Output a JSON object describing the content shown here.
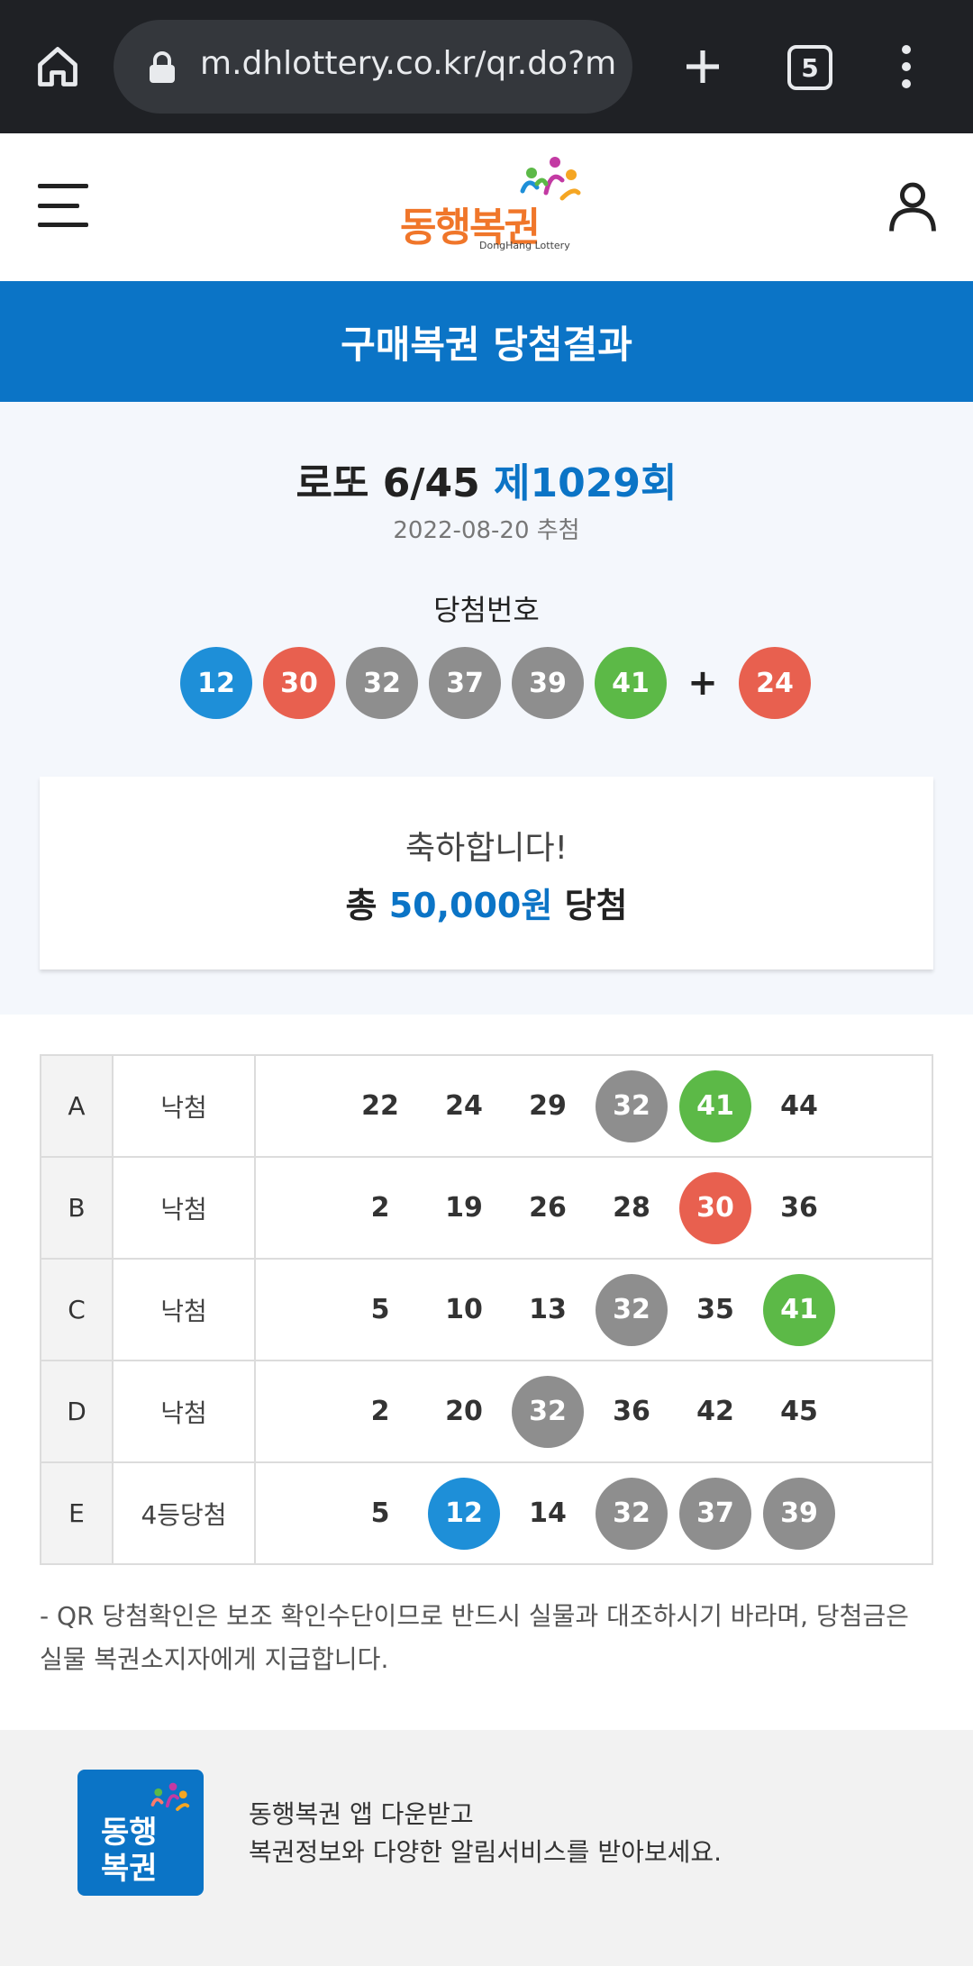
{
  "browser": {
    "url": "m.dhlottery.co.kr/qr.do?method=winQr",
    "tab_count": "5"
  },
  "header": {
    "logo_text": "동행복권",
    "logo_sub": "DongHang Lottery"
  },
  "banner": {
    "title": "구매복권 당첨결과"
  },
  "draw": {
    "game_name": "로또 6/45",
    "round": "제1029회",
    "date": "2022-08-20 추첨",
    "win_label": "당첨번호",
    "numbers": [
      {
        "value": "12",
        "color": "#1e8fd8"
      },
      {
        "value": "30",
        "color": "#e8604f"
      },
      {
        "value": "32",
        "color": "#8e8e8e"
      },
      {
        "value": "37",
        "color": "#8e8e8e"
      },
      {
        "value": "39",
        "color": "#8e8e8e"
      },
      {
        "value": "41",
        "color": "#5cb947"
      }
    ],
    "plus": "+",
    "bonus": {
      "value": "24",
      "color": "#e8604f"
    }
  },
  "congrats": {
    "line1": "축하합니다!",
    "prefix": "총",
    "amount": "50,000원",
    "suffix": "당첨"
  },
  "results": [
    {
      "game": "A",
      "status": "낙첨",
      "numbers": [
        {
          "value": "22"
        },
        {
          "value": "24"
        },
        {
          "value": "29"
        },
        {
          "value": "32",
          "color": "#8e8e8e"
        },
        {
          "value": "41",
          "color": "#5cb947"
        },
        {
          "value": "44"
        }
      ]
    },
    {
      "game": "B",
      "status": "낙첨",
      "numbers": [
        {
          "value": "2"
        },
        {
          "value": "19"
        },
        {
          "value": "26"
        },
        {
          "value": "28"
        },
        {
          "value": "30",
          "color": "#e8604f"
        },
        {
          "value": "36"
        }
      ]
    },
    {
      "game": "C",
      "status": "낙첨",
      "numbers": [
        {
          "value": "5"
        },
        {
          "value": "10"
        },
        {
          "value": "13"
        },
        {
          "value": "32",
          "color": "#8e8e8e"
        },
        {
          "value": "35"
        },
        {
          "value": "41",
          "color": "#5cb947"
        }
      ]
    },
    {
      "game": "D",
      "status": "낙첨",
      "numbers": [
        {
          "value": "2"
        },
        {
          "value": "20"
        },
        {
          "value": "32",
          "color": "#8e8e8e"
        },
        {
          "value": "36"
        },
        {
          "value": "42"
        },
        {
          "value": "45"
        }
      ]
    },
    {
      "game": "E",
      "status": "4등당첨",
      "numbers": [
        {
          "value": "5"
        },
        {
          "value": "12",
          "color": "#1e8fd8"
        },
        {
          "value": "14"
        },
        {
          "value": "32",
          "color": "#8e8e8e"
        },
        {
          "value": "37",
          "color": "#8e8e8e"
        },
        {
          "value": "39",
          "color": "#8e8e8e"
        }
      ]
    }
  ],
  "notice": "- QR 당첨확인은 보조 확인수단이므로 반드시 실물과 대조하시기 바라며, 당첨금은 실물 복권소지자에게 지급합니다.",
  "app_banner": {
    "icon_text": "동행복권",
    "line1": "동행복권 앱 다운받고",
    "line2": "복권정보와 다양한 알림서비스를 받아보세요."
  }
}
